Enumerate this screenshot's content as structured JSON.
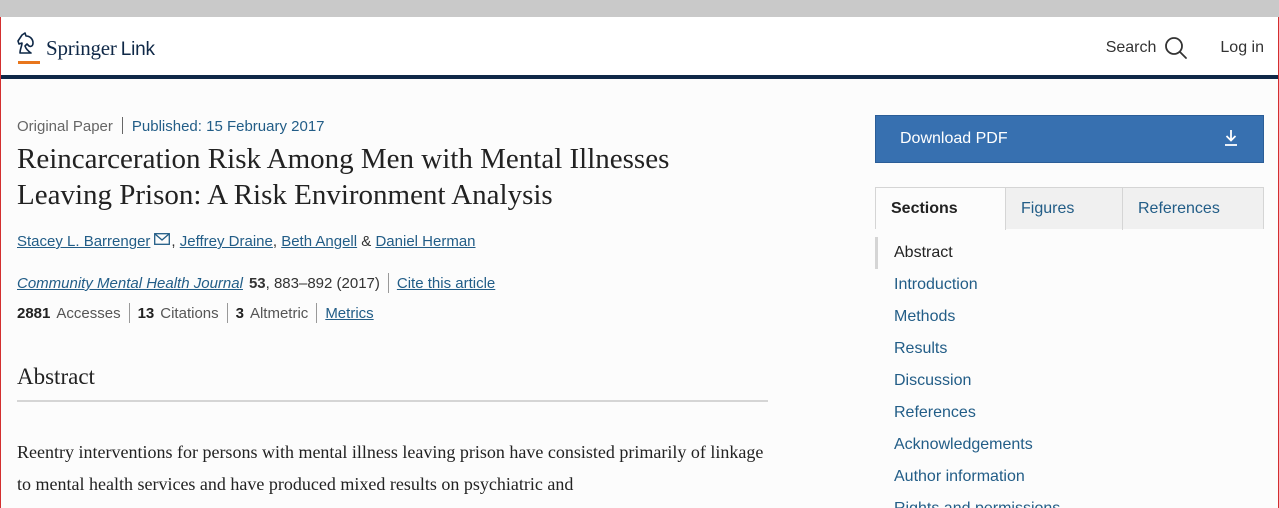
{
  "header": {
    "brand": "Springer",
    "brand_suffix": "Link",
    "search_label": "Search",
    "login_label": "Log in"
  },
  "article": {
    "type": "Original Paper",
    "published": "Published: 15 February 2017",
    "title": "Reincarceration Risk Among Men with Mental Illnesses Leaving Prison: A Risk Environment Analysis",
    "authors": [
      "Stacey L. Barrenger",
      "Jeffrey Draine",
      "Beth Angell",
      "Daniel Herman"
    ],
    "author_sep": ",",
    "author_and": "&",
    "journal": "Community Mental Health Journal",
    "volume": "53",
    "pages_year": ", 883–892 (2017)",
    "cite_label": "Cite this article",
    "metrics": {
      "accesses_value": "2881",
      "accesses_label": "Accesses",
      "citations_value": "13",
      "citations_label": "Citations",
      "altmetric_value": "3",
      "altmetric_label": "Altmetric",
      "metrics_link": "Metrics"
    },
    "abstract_heading": "Abstract",
    "abstract_text": "Reentry interventions for persons with mental illness leaving prison have consisted primarily of linkage to mental health services and have produced mixed results on psychiatric and"
  },
  "sidebar": {
    "download_label": "Download PDF",
    "tabs": [
      "Sections",
      "Figures",
      "References"
    ],
    "sections": [
      "Abstract",
      "Introduction",
      "Methods",
      "Results",
      "Discussion",
      "References",
      "Acknowledgements",
      "Author information",
      "Rights and permissions"
    ]
  },
  "colors": {
    "link": "#225d87",
    "header_rule": "#0f2847",
    "brand_accent": "#e8761c",
    "pdf_button": "#3770b0"
  }
}
